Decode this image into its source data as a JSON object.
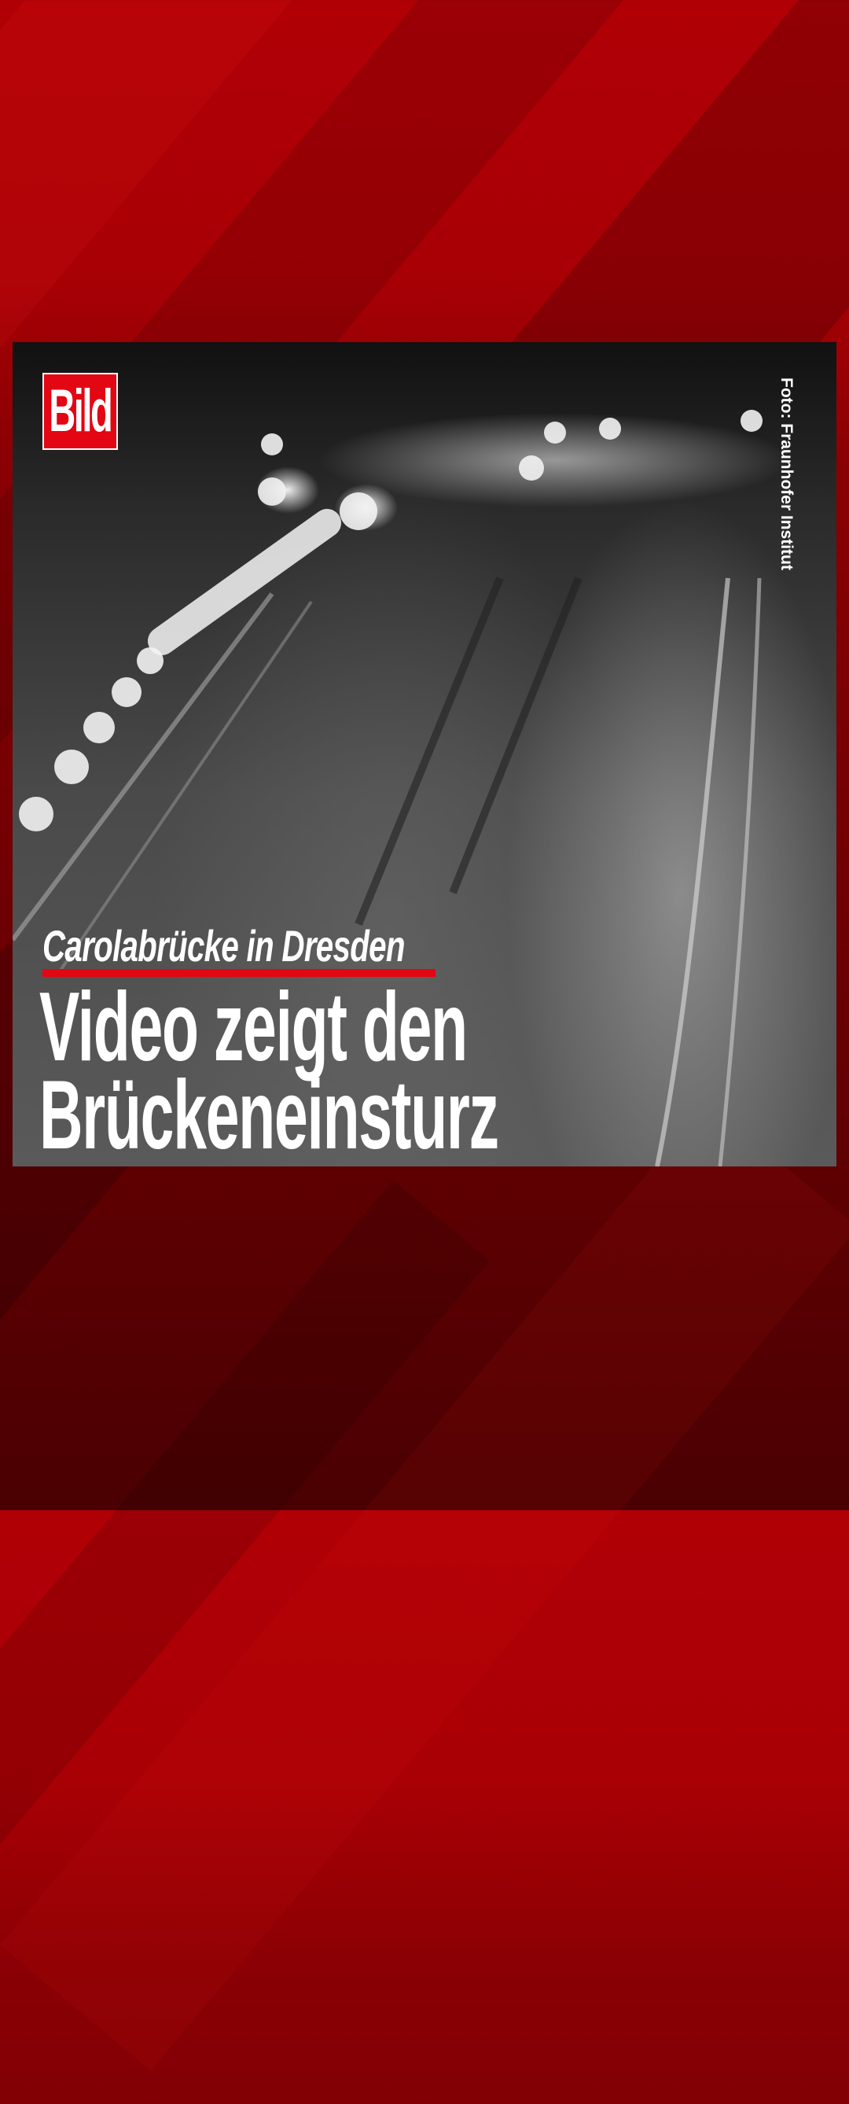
{
  "brand": {
    "logo_text": "Bild",
    "accent": "#e30613"
  },
  "photo": {
    "credit": "Foto: Fraunhofer Institut"
  },
  "story": {
    "kicker": "Carolabrücke in Dresden",
    "headline_line1": "Video zeigt den",
    "headline_line2": "Brückeneinsturz"
  }
}
